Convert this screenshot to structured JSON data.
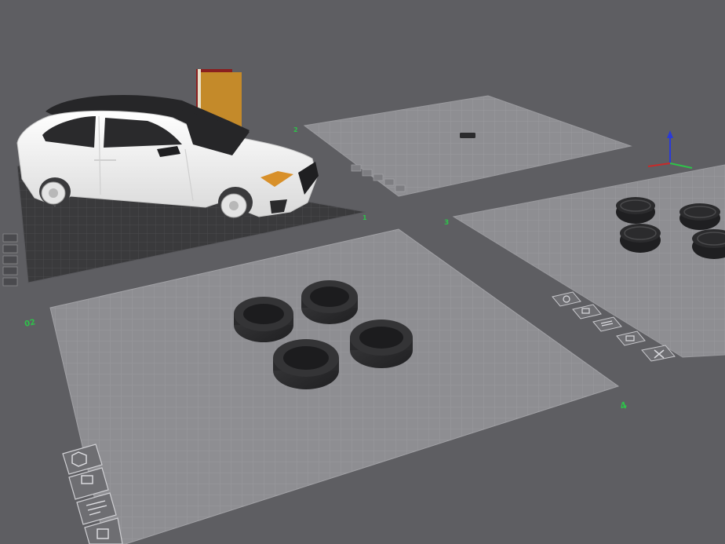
{
  "app": {
    "view": "3d-build-plates"
  },
  "colors": {
    "background": "#5e5e62",
    "plate_light": "#8a8a8e",
    "plate_dark": "#3a3a3c",
    "grid_light": "#9b9b9f",
    "grid_dark": "#4a4a4e",
    "plate_label": "#2ec24a",
    "tire": "#2e2e30",
    "car_body": "#f2f2f2",
    "car_roof": "#262628"
  },
  "plates": [
    {
      "id": "plate-1",
      "label": "1",
      "style": "dark",
      "objects": "car-body"
    },
    {
      "id": "plate-2",
      "label": "2",
      "style": "light",
      "objects": "small-part"
    },
    {
      "id": "plate-3",
      "label": "3",
      "style": "light",
      "objects": "wheels"
    },
    {
      "id": "plate-4",
      "label": "4",
      "style": "light",
      "objects": "tires"
    }
  ],
  "plate_labels": {
    "plate_1_front": "1",
    "plate_2_front": "2",
    "plate_3_side": "3",
    "plate_4_side": "02",
    "plate_4_front": "4"
  },
  "toolbar_icons": {
    "plate_4": [
      "orient-icon",
      "arrange-icon",
      "slice-settings-icon",
      "lock-icon"
    ],
    "plate_3": [
      "orient-icon",
      "arrange-icon",
      "slice-settings-icon",
      "lock-icon",
      "remove-icon"
    ],
    "plate_1": [
      "orient-icon",
      "arrange-icon",
      "slice-settings-icon",
      "lock-icon",
      "remove-icon"
    ]
  },
  "axes": [
    "x-axis",
    "y-axis",
    "z-axis"
  ]
}
